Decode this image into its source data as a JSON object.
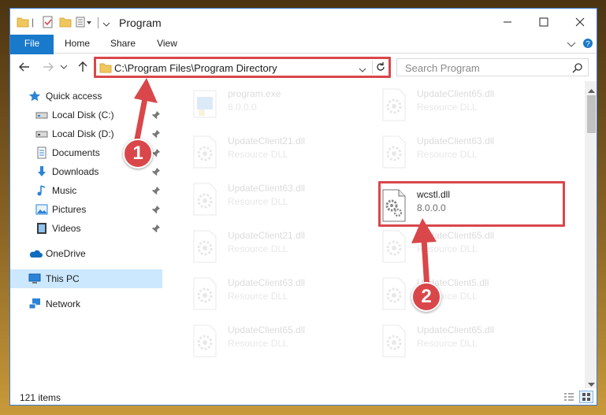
{
  "window": {
    "title": "Program",
    "quick_access_mark": "|",
    "controls": {
      "minimize": "minimize-icon",
      "maximize": "maximize-icon",
      "close": "close-icon"
    }
  },
  "ribbon": {
    "tabs": [
      "File",
      "Home",
      "Share",
      "View"
    ]
  },
  "address": {
    "path": "C:\\Program Files\\Program Directory"
  },
  "search": {
    "placeholder": "Search Program"
  },
  "sidebar": {
    "items": [
      {
        "label": "Quick access",
        "icon": "star-icon"
      },
      {
        "label": "Local Disk (C:)",
        "icon": "drive-icon",
        "pinned": true
      },
      {
        "label": "Local Disk (D:)",
        "icon": "drive-icon",
        "pinned": true
      },
      {
        "label": "Documents",
        "icon": "documents-icon",
        "pinned": true
      },
      {
        "label": "Downloads",
        "icon": "downloads-icon",
        "pinned": true
      },
      {
        "label": "Music",
        "icon": "music-icon",
        "pinned": true
      },
      {
        "label": "Pictures",
        "icon": "pictures-icon",
        "pinned": true
      },
      {
        "label": "Videos",
        "icon": "videos-icon",
        "pinned": true
      },
      {
        "label": "OneDrive",
        "icon": "cloud-icon"
      },
      {
        "label": "This PC",
        "icon": "computer-icon",
        "selected": true
      },
      {
        "label": "Network",
        "icon": "network-icon"
      }
    ]
  },
  "files": [
    {
      "name": "program.exe",
      "type": "8.0.0.0",
      "icon": "exe-icon",
      "faded": true
    },
    {
      "name": "UpdateClient65.dll",
      "type": "Resource DLL",
      "icon": "dll-icon",
      "faded": true
    },
    {
      "name": "UpdateClient21.dll",
      "type": "Resource DLL",
      "icon": "dll-icon",
      "faded": true
    },
    {
      "name": "UpdateClient63.dll",
      "type": "Resource DLL",
      "icon": "dll-icon",
      "faded": true
    },
    {
      "name": "UpdateClient63.dll",
      "type": "Resource DLL",
      "icon": "dll-icon",
      "faded": true
    },
    {
      "name": "wcstl.dll",
      "type": "8.0.0.0",
      "icon": "dll-icon",
      "faded": false
    },
    {
      "name": "UpdateClient21.dll",
      "type": "Resource DLL",
      "icon": "dll-icon",
      "faded": true
    },
    {
      "name": "UpdateClient65.dll",
      "type": "Resource DLL",
      "icon": "dll-icon",
      "faded": true
    },
    {
      "name": "UpdateClient63.dll",
      "type": "Resource DLL",
      "icon": "dll-icon",
      "faded": true
    },
    {
      "name": "UpdateClient5.dll",
      "type": "Resource DLL",
      "icon": "dll-icon",
      "faded": true
    },
    {
      "name": "UpdateClient65.dll",
      "type": "Resource DLL",
      "icon": "dll-icon",
      "faded": true
    },
    {
      "name": "UpdateClient65.dll",
      "type": "Resource DLL",
      "icon": "dll-icon",
      "faded": true
    }
  ],
  "status": {
    "item_count": "121 items"
  },
  "annotations": {
    "callout_1": "1",
    "callout_2": "2",
    "color": "#d9474a"
  },
  "colors": {
    "accent": "#1979ca",
    "selected": "#cce8ff",
    "highlight": "#d9474a"
  }
}
